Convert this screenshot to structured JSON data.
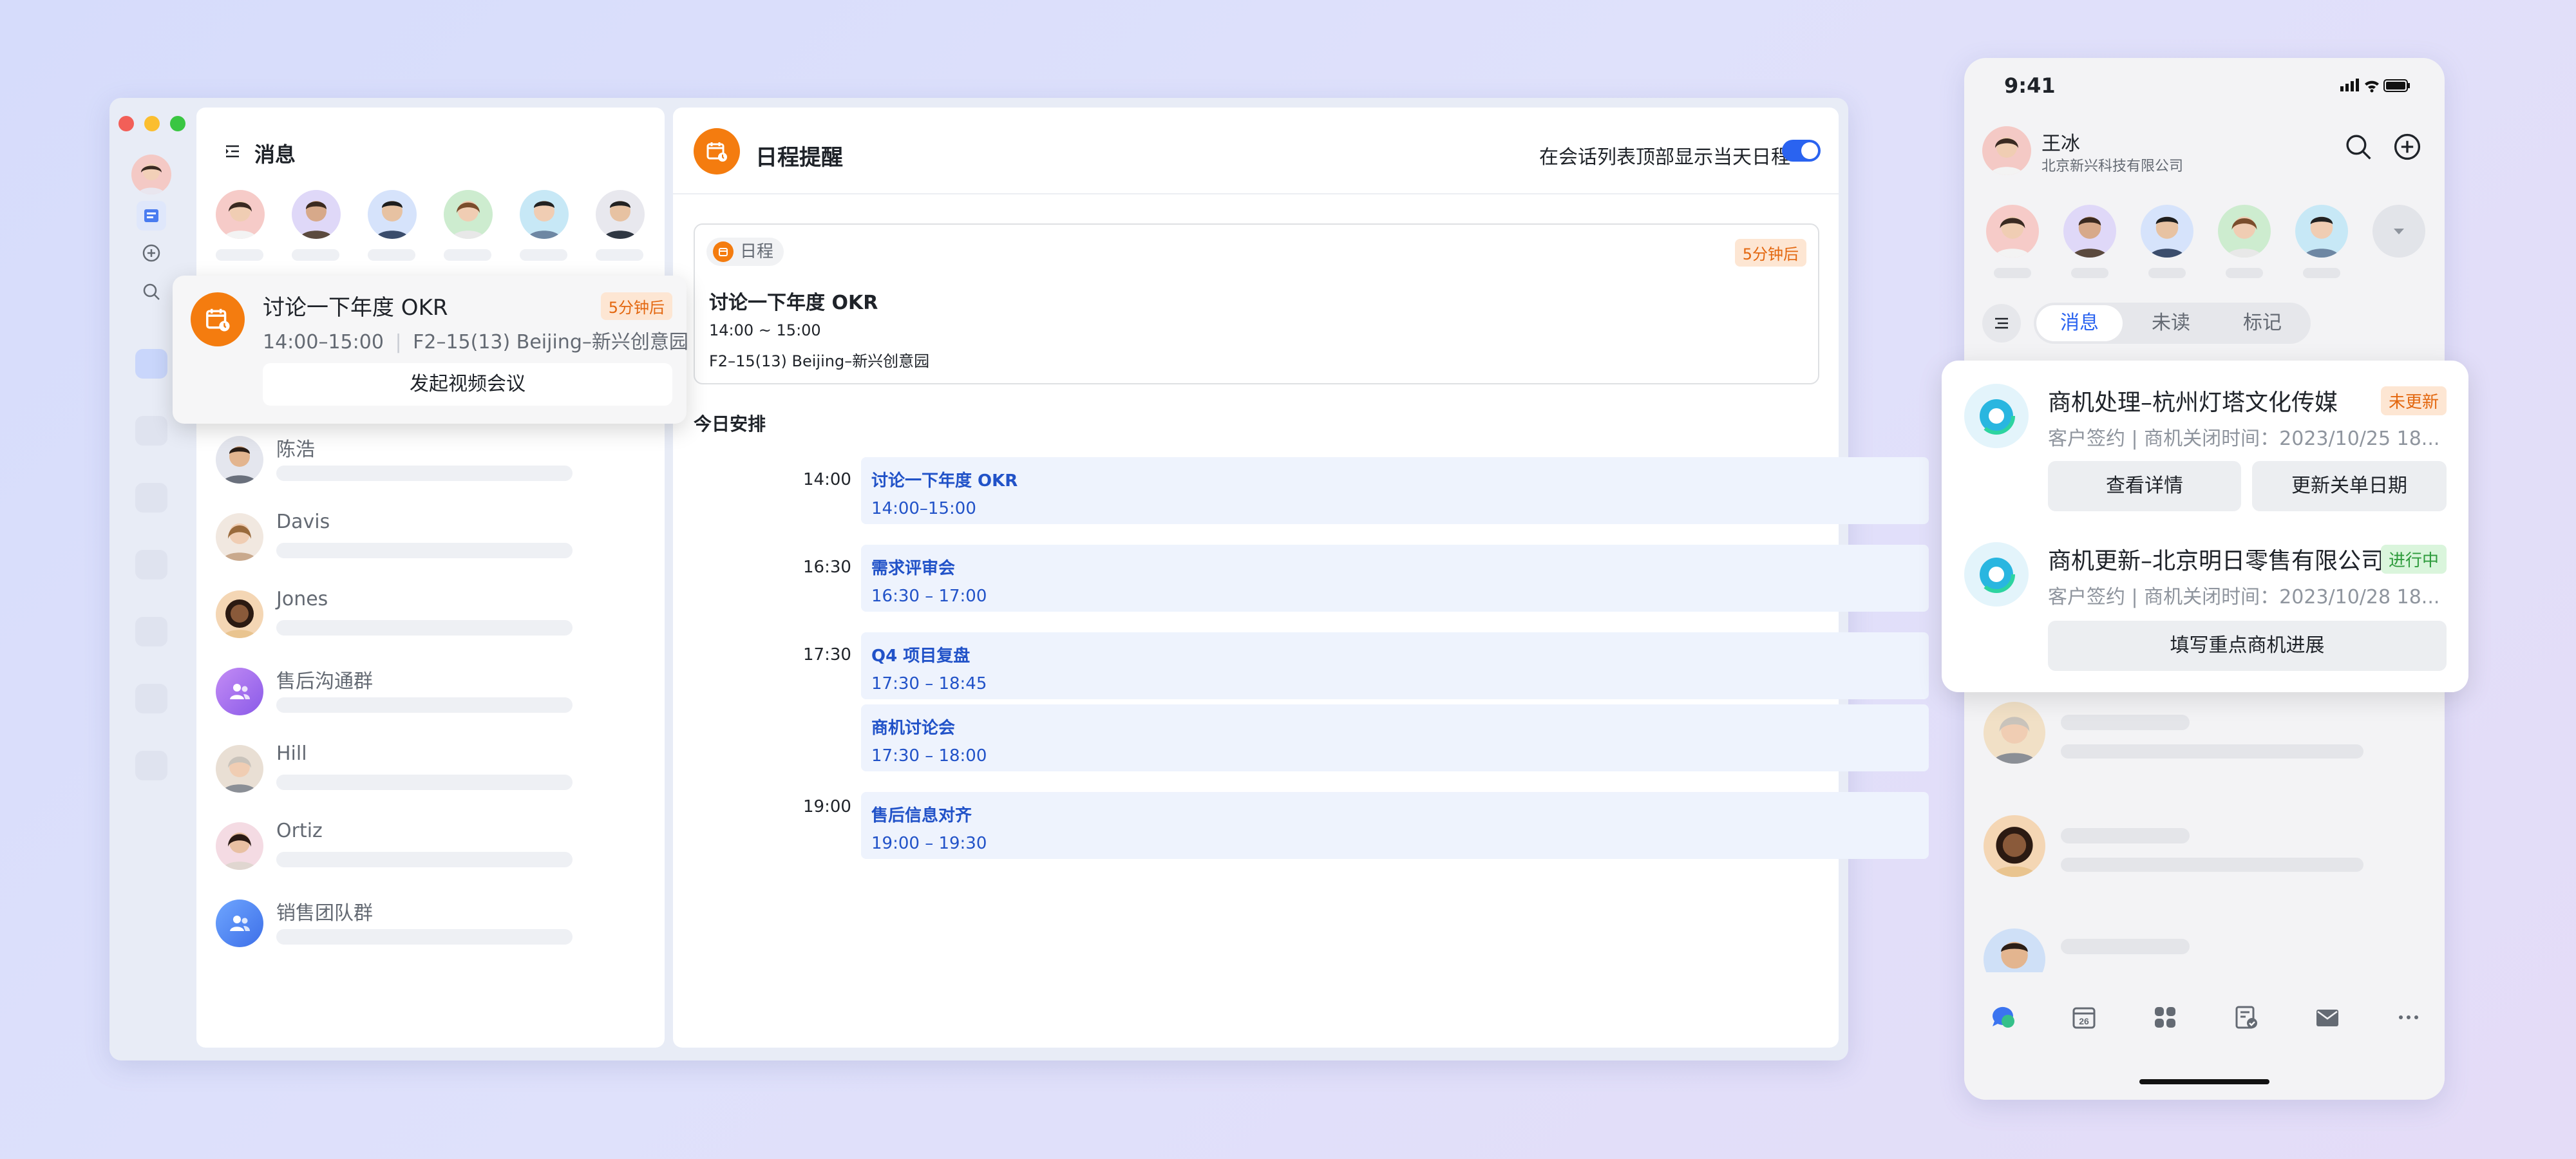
{
  "colors": {
    "accent": "#2a63f0",
    "orange": "#f47c0f",
    "badge_orange_bg": "#fde6d3",
    "badge_green_bg": "#daf5dc"
  },
  "desktop": {
    "messages": {
      "title": "消息",
      "contacts": [
        {
          "name": "陈浩"
        },
        {
          "name": "Davis"
        },
        {
          "name": "Jones"
        },
        {
          "name": "售后沟通群"
        },
        {
          "name": "Hill"
        },
        {
          "name": "Ortiz"
        },
        {
          "name": "销售团队群"
        }
      ]
    },
    "popup": {
      "title": "讨论一下年度 OKR",
      "badge": "5分钟后",
      "time": "14:00–15:00",
      "location": "F2–15(13) Beijing–新兴创意园",
      "button": "发起视频会议"
    },
    "schedule": {
      "title": "日程提醒",
      "toggle_label": "在会话列表顶部显示当天日程",
      "toggle_on": true,
      "card": {
        "tag": "日程",
        "badge": "5分钟后",
        "title": "讨论一下年度 OKR",
        "time": "14:00 ~ 15:00",
        "location": "F2–15(13) Beijing–新兴创意园"
      },
      "today_label": "今日安排",
      "slots": [
        {
          "time": "14:00",
          "events": [
            {
              "title": "讨论一下年度 OKR",
              "time": "14:00–15:00"
            }
          ]
        },
        {
          "time": "16:30",
          "events": [
            {
              "title": "需求评审会",
              "time": "16:30 – 17:00"
            }
          ]
        },
        {
          "time": "17:30",
          "events": [
            {
              "title": "Q4 项目复盘",
              "time": "17:30 – 18:45"
            },
            {
              "title": "商机讨论会",
              "time": "17:30 – 18:00"
            }
          ]
        },
        {
          "time": "19:00",
          "events": [
            {
              "title": "售后信息对齐",
              "time": "19:00 – 19:30"
            }
          ]
        }
      ]
    }
  },
  "phone": {
    "status_time": "9:41",
    "user": {
      "name": "王冰",
      "company": "北京新兴科技有限公司"
    },
    "tabs": [
      "消息",
      "未读",
      "标记"
    ],
    "active_tab": 0,
    "card": {
      "items": [
        {
          "title": "商机处理–杭州灯塔文化传媒",
          "badge": "未更新",
          "sub": "客户签约 | 商机关闭时间：2023/10/25 18...",
          "buttons": [
            "查看详情",
            "更新关单日期"
          ]
        },
        {
          "title": "商机更新–北京明日零售有限公司",
          "badge": "进行中",
          "sub": "客户签约 | 商机关闭时间：2023/10/28 18...",
          "buttons": [
            "填写重点商机进展"
          ]
        }
      ]
    },
    "bottom_nav": [
      "chat-icon",
      "calendar-icon",
      "apps-icon",
      "approval-icon",
      "mail-icon",
      "more-icon"
    ],
    "calendar_day": "26"
  }
}
